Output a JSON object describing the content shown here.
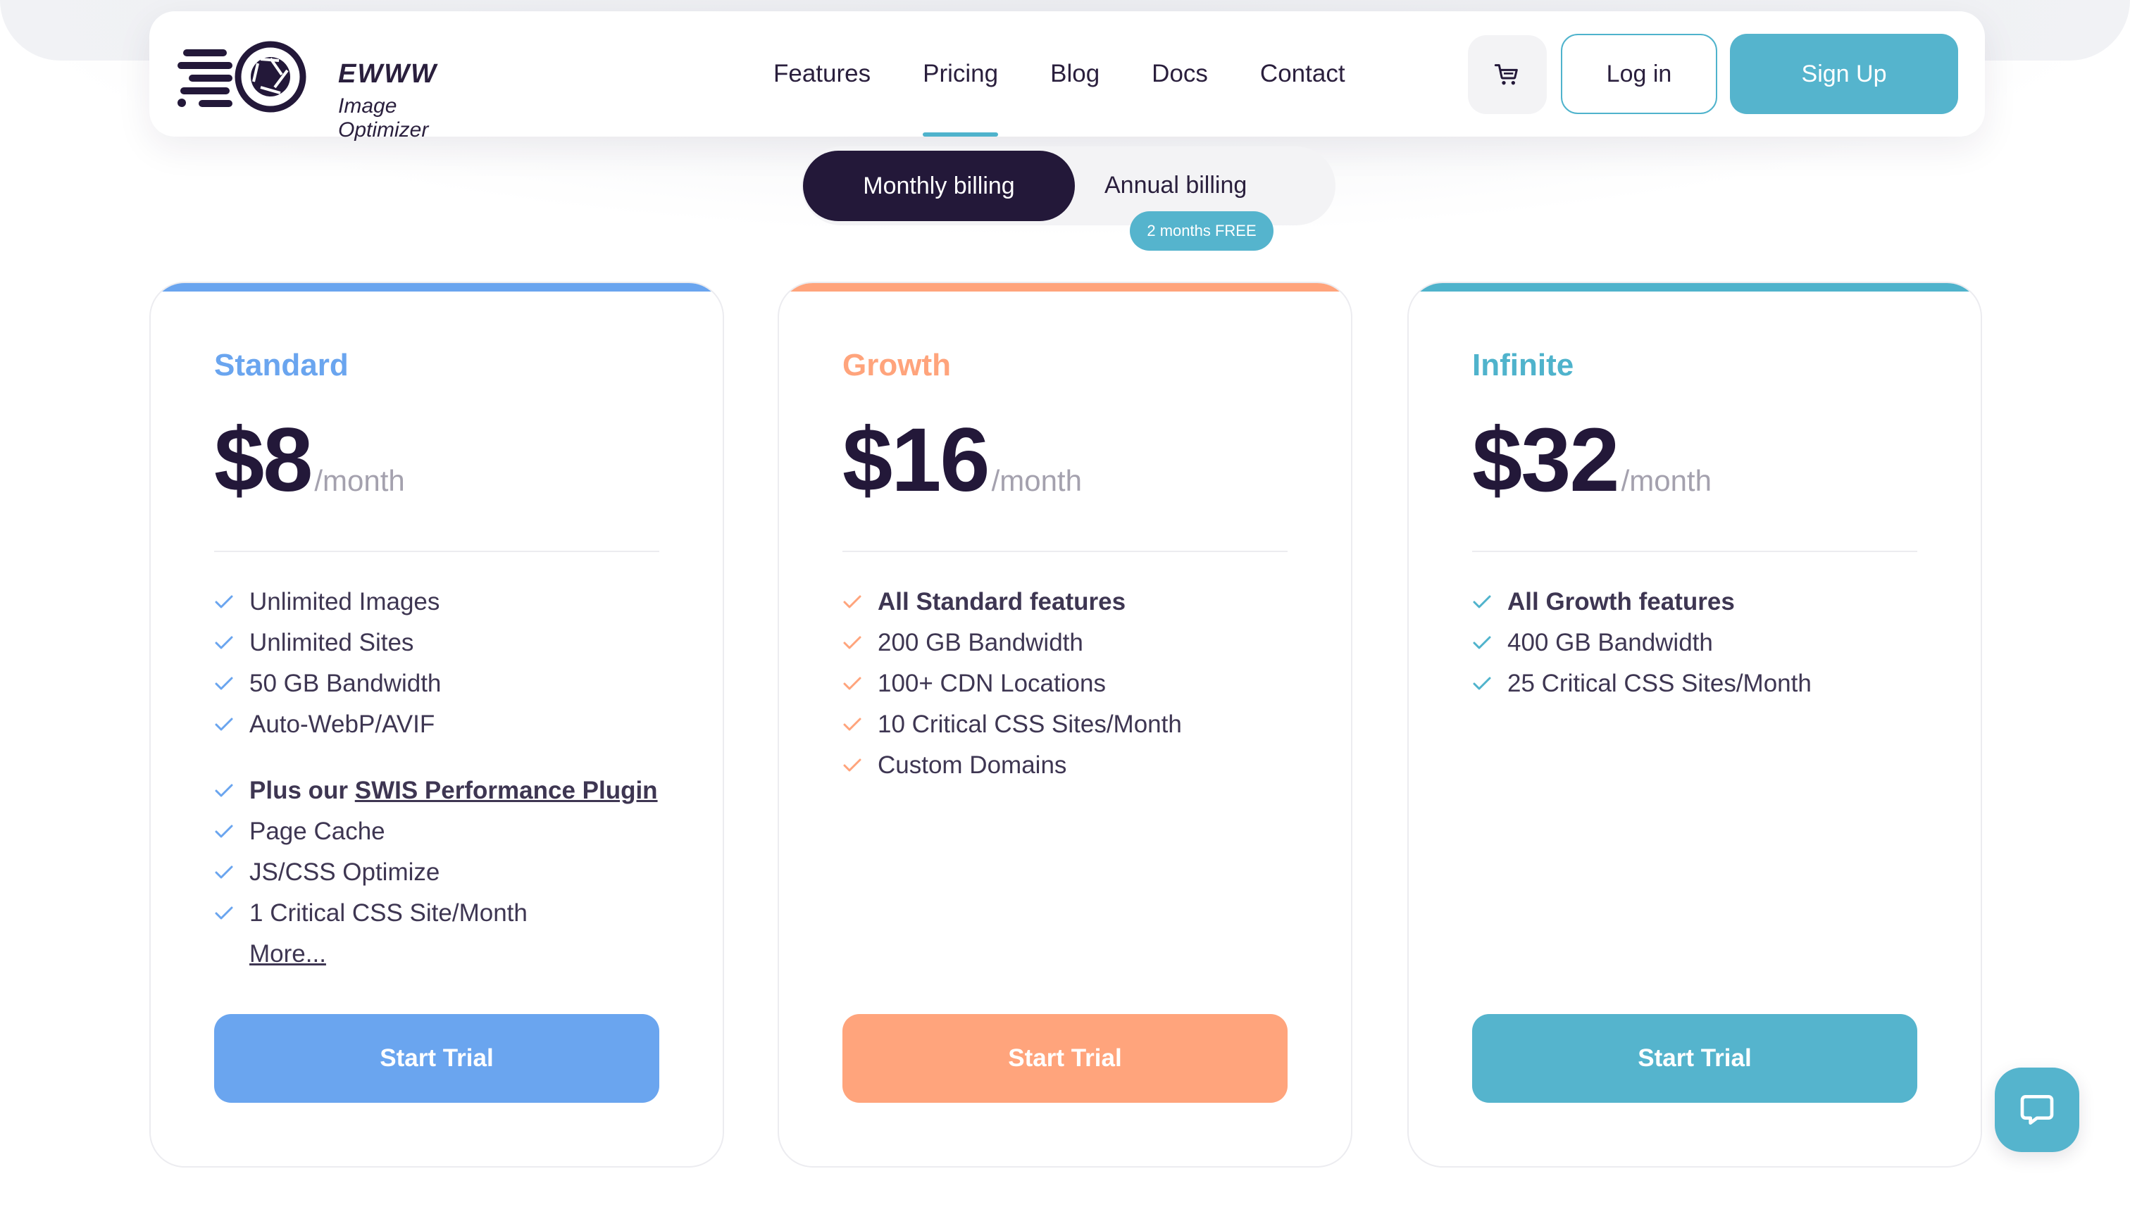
{
  "brand": {
    "name": "EWWW",
    "tagline": "Image Optimizer"
  },
  "nav": {
    "items": [
      {
        "label": "Features"
      },
      {
        "label": "Pricing",
        "active": true
      },
      {
        "label": "Blog"
      },
      {
        "label": "Docs"
      },
      {
        "label": "Contact"
      }
    ],
    "cart_icon": "cart-icon",
    "login_label": "Log in",
    "signup_label": "Sign Up"
  },
  "billing": {
    "monthly_label": "Monthly billing",
    "annual_label": "Annual billing",
    "annual_badge": "2 months FREE",
    "selected": "monthly"
  },
  "plans": [
    {
      "name": "Standard",
      "price": "$8",
      "period": "/month",
      "accent_color": "#6aa5ef",
      "features": [
        "Unlimited Images",
        "Unlimited Sites",
        "50 GB Bandwidth",
        "Auto-WebP/AVIF"
      ],
      "extra": {
        "intro": "Plus our ",
        "link": "SWIS Performance Plugin",
        "features": [
          "Page Cache",
          "JS/CSS Optimize",
          "1 Critical CSS Site/Month"
        ],
        "more": "More..."
      },
      "cta": "Start Trial"
    },
    {
      "name": "Growth",
      "price": "$16",
      "period": "/month",
      "accent_color": "#ffa47c",
      "features": [
        "All Standard features",
        "200 GB Bandwidth",
        "100+ CDN Locations",
        "10 Critical CSS Sites/Month",
        "Custom Domains"
      ],
      "cta": "Start Trial"
    },
    {
      "name": "Infinite",
      "price": "$32",
      "period": "/month",
      "accent_color": "#4fb3cc",
      "features": [
        "All Growth features",
        "400 GB Bandwidth",
        "25 Critical CSS Sites/Month"
      ],
      "cta": "Start Trial"
    }
  ],
  "chat": {
    "icon": "chat-bubble-icon"
  },
  "colors": {
    "dark": "#231839",
    "teal": "#55b4cd",
    "muted": "#a4a1ae"
  }
}
